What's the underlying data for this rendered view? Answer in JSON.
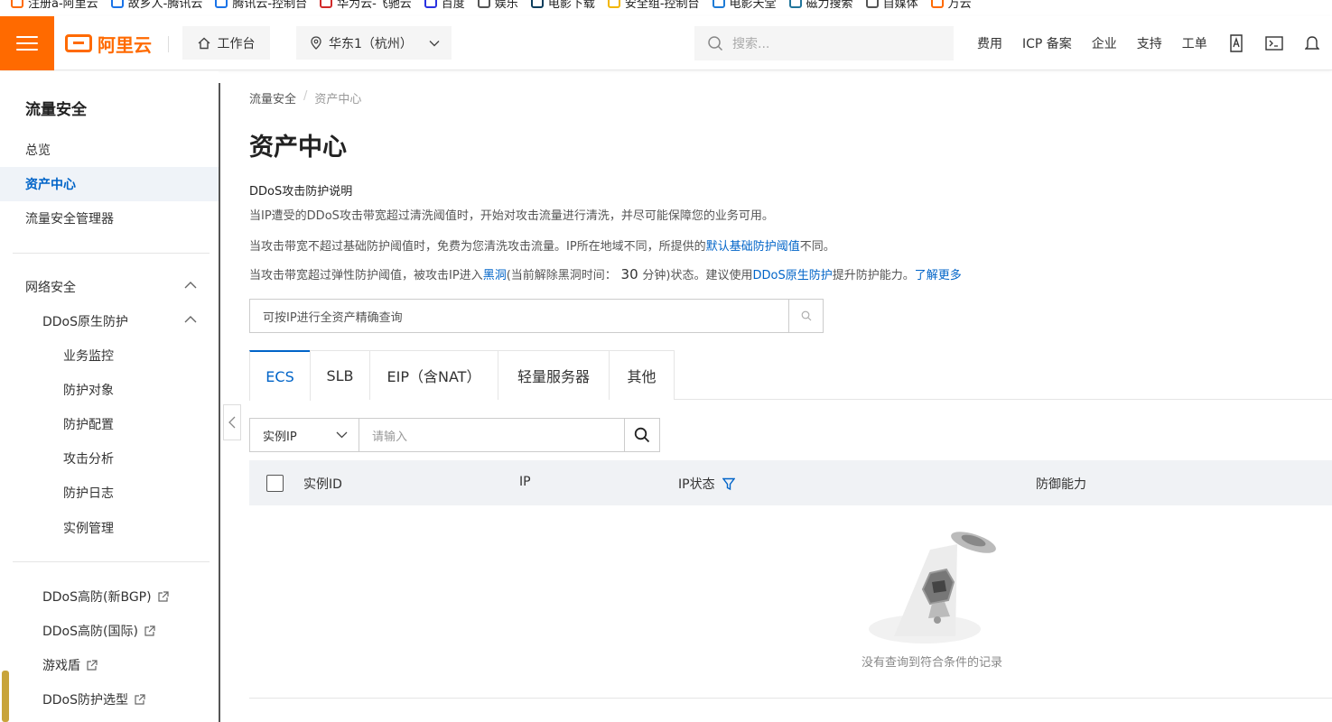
{
  "bookmarks": [
    {
      "label": "注册a-阿里云",
      "color": "#ff6a00"
    },
    {
      "label": "故乡人-腾讯云",
      "color": "#1a73e8"
    },
    {
      "label": "腾讯云-控制台",
      "color": "#1a73e8"
    },
    {
      "label": "华为云-飞驰云",
      "color": "#d12a2a"
    },
    {
      "label": "百度",
      "color": "#2932e1"
    },
    {
      "label": "娱乐",
      "color": "#555555"
    },
    {
      "label": "电影下载",
      "color": "#0b3d5c"
    },
    {
      "label": "安全组-控制台",
      "color": "#f2b600"
    },
    {
      "label": "电影天堂",
      "color": "#1e7bd6"
    },
    {
      "label": "磁力搜索",
      "color": "#21759b"
    },
    {
      "label": "自媒体",
      "color": "#555555"
    },
    {
      "label": "万云",
      "color": "#ff6a00"
    }
  ],
  "header": {
    "logo_text": "阿里云",
    "workbench_label": "工作台",
    "region_label": "华东1（杭州）",
    "search_placeholder": "搜索...",
    "nav": [
      "费用",
      "ICP 备案",
      "企业",
      "支持",
      "工单"
    ],
    "brand_color": "#ff6a00"
  },
  "sidebar": {
    "title": "流量安全",
    "items_top": [
      "总览",
      "资产中心",
      "流量安全管理器"
    ],
    "active_item": "资产中心",
    "network_security": "网络安全",
    "ddos_native": "DDoS原生防护",
    "sub_items": [
      "业务监控",
      "防护对象",
      "防护配置",
      "攻击分析",
      "防护日志",
      "实例管理"
    ],
    "external_items": [
      "DDoS高防(新BGP)",
      "DDoS高防(国际)",
      "游戏盾",
      "DDoS防护选型"
    ]
  },
  "main": {
    "breadcrumb": [
      "流量安全",
      "资产中心"
    ],
    "breadcrumb_sep": "/",
    "title": "资产中心",
    "desc_title": "DDoS攻击防护说明",
    "line1": "当IP遭受的DDoS攻击带宽超过清洗阈值时，开始对攻击流量进行清洗，并尽可能保障您的业务可用。",
    "line2_a": "当攻击带宽不超过基础防护阈值时，免费为您清洗攻击流量。IP所在地域不同，所提供的",
    "line2_link": "默认基础防护阈值",
    "line2_b": "不同。",
    "line3_a": "当攻击带宽超过弹性防护阈值，被攻击IP进入",
    "line3_link1": "黑洞",
    "line3_b": "(当前解除黑洞时间：",
    "line3_num": " 30 ",
    "line3_c": "分钟)状态。建议使用",
    "line3_link2": "DDoS原生防护",
    "line3_d": "提升防护能力。",
    "line3_link3": "了解更多",
    "ip_query_placeholder": "可按IP进行全资产精确查询",
    "tabs": [
      "ECS",
      "SLB",
      "EIP（含NAT）",
      "轻量服务器",
      "其他"
    ],
    "active_tab": "ECS",
    "filter_select": "实例IP",
    "filter_placeholder": "请输入",
    "columns": [
      "实例ID",
      "IP",
      "IP状态",
      "防御能力"
    ],
    "empty_text": "没有查询到符合条件的记录",
    "link_color": "#0064c8"
  }
}
